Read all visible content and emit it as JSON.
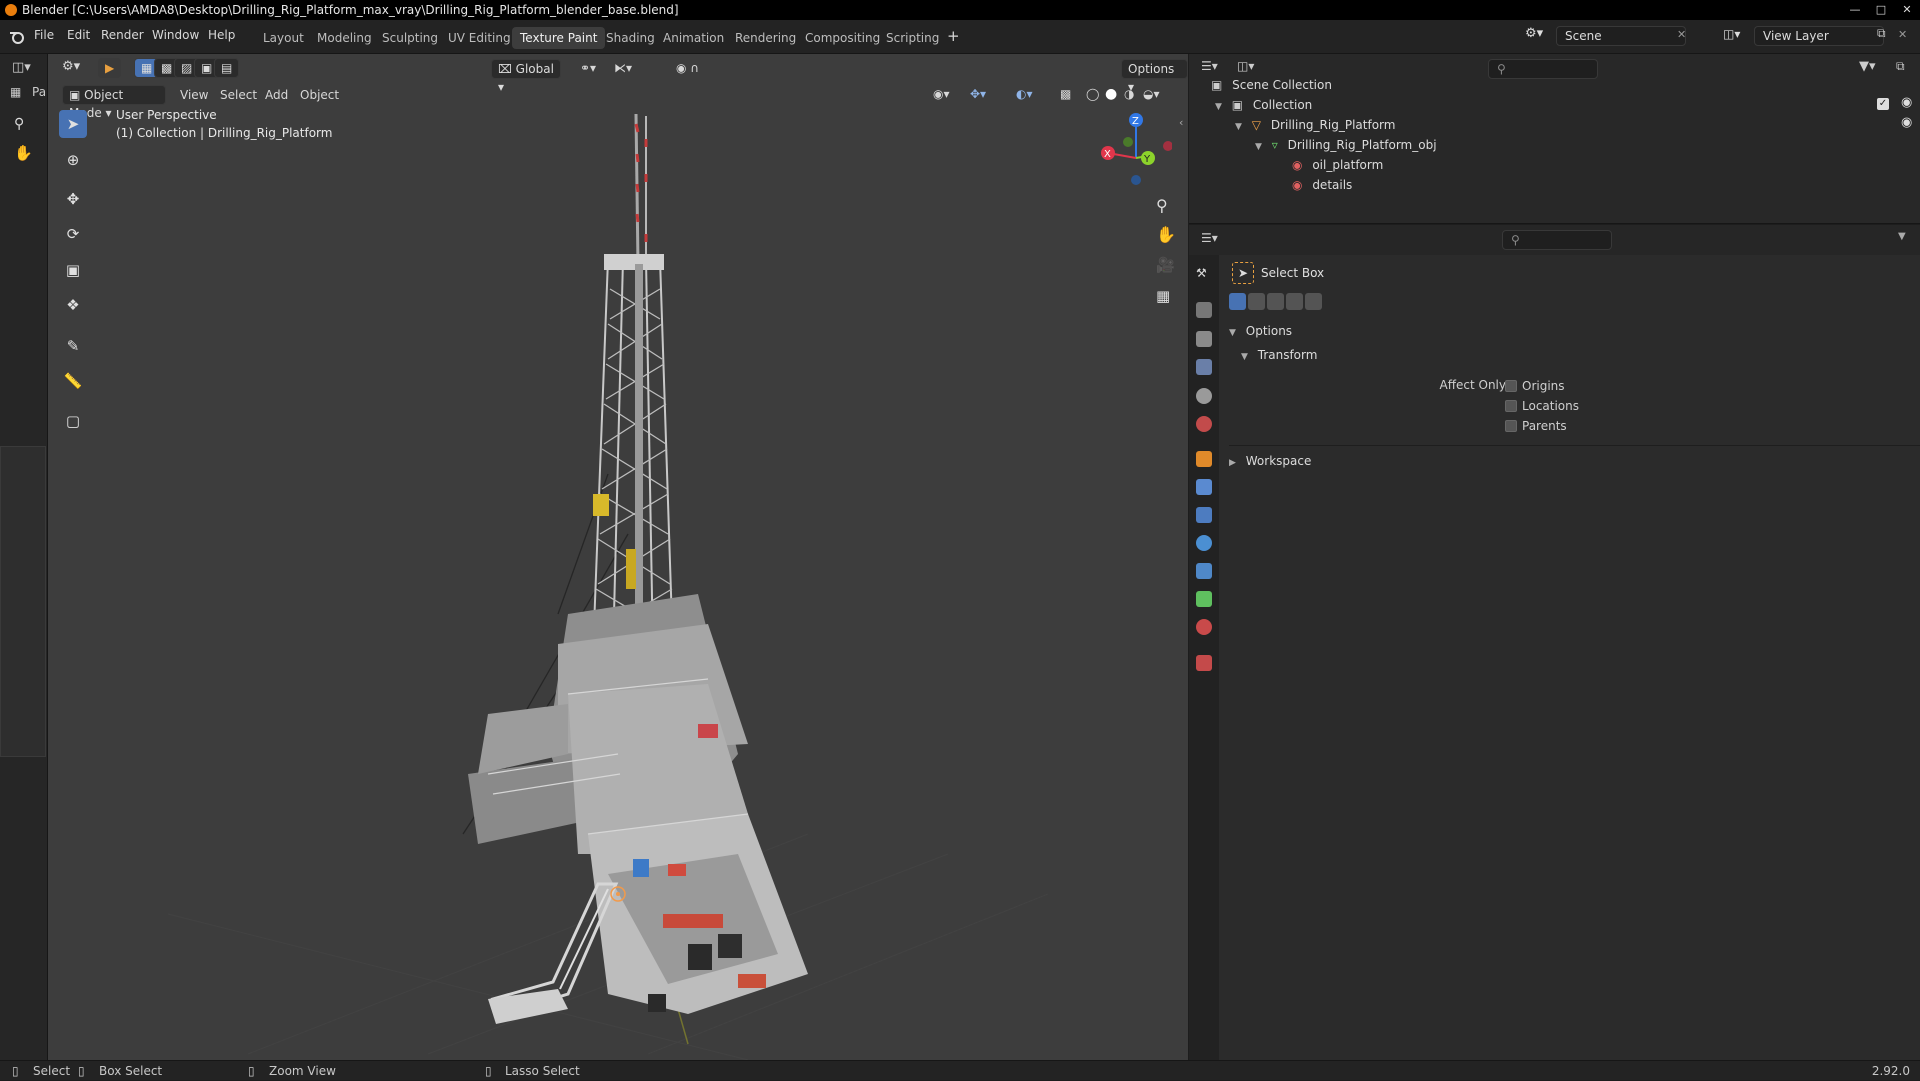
{
  "window": {
    "title": "Blender [C:\\Users\\AMDA8\\Desktop\\Drilling_Rig_Platform_max_vray\\Drilling_Rig_Platform_blender_base.blend]"
  },
  "menu": [
    "File",
    "Edit",
    "Render",
    "Window",
    "Help"
  ],
  "workspaces": [
    "Layout",
    "Modeling",
    "Sculpting",
    "UV Editing",
    "Texture Paint",
    "Shading",
    "Animation",
    "Rendering",
    "Compositing",
    "Scripting"
  ],
  "active_workspace": "Texture Paint",
  "scene": {
    "name": "Scene",
    "view_layer": "View Layer"
  },
  "viewport": {
    "transform_orientation": "Global",
    "options_label": "Options",
    "mode": "Object Mode",
    "menus": [
      "View",
      "Select",
      "Add",
      "Object"
    ],
    "overlay_line1": "User Perspective",
    "overlay_line2": "(1) Collection | Drilling_Rig_Platform",
    "side_label": "Pa",
    "gizmo": {
      "x": "X",
      "y": "Y",
      "z": "Z"
    }
  },
  "outliner": {
    "items": [
      {
        "label": "Scene Collection",
        "depth": 0,
        "icon": "scene-collection-icon"
      },
      {
        "label": "Collection",
        "depth": 1,
        "icon": "collection-icon"
      },
      {
        "label": "Drilling_Rig_Platform",
        "depth": 2,
        "icon": "object-icon"
      },
      {
        "label": "Drilling_Rig_Platform_obj",
        "depth": 3,
        "icon": "mesh-icon"
      },
      {
        "label": "oil_platform",
        "depth": 4,
        "icon": "material-icon"
      },
      {
        "label": "details",
        "depth": 4,
        "icon": "material-icon"
      }
    ]
  },
  "properties": {
    "tool_name": "Select Box",
    "options_label": "Options",
    "transform_label": "Transform",
    "affect_only_label": "Affect Only",
    "checkboxes": [
      "Origins",
      "Locations",
      "Parents"
    ],
    "workspace_label": "Workspace"
  },
  "statusbar": {
    "items": [
      "Select",
      "Box Select",
      "Zoom View",
      "Lasso Select"
    ],
    "version": "2.92.0"
  },
  "colors": {
    "accent": "#4772b3",
    "active_tab": "#3d3d3d",
    "viewport_bg": "#3d3d3d",
    "axis_x": "#e0364b",
    "axis_y": "#8cd32b",
    "axis_z": "#3178e7"
  }
}
